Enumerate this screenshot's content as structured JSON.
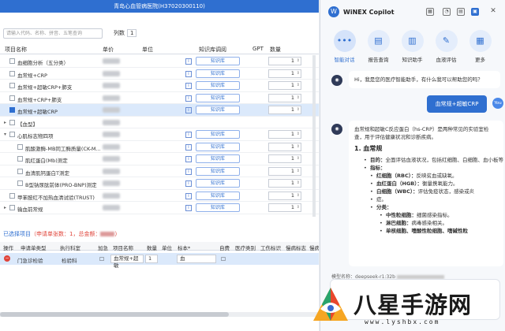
{
  "window": {
    "title": "青岛心血管病医院(H37020300110)"
  },
  "search": {
    "placeholder": "请输入代码、名称、拼音、五笔查询",
    "columns_label": "列数",
    "columns_value": "1"
  },
  "table": {
    "headers": [
      "项目名称",
      "单价",
      "单位",
      "知识库调阅",
      "GPT",
      "数量"
    ],
    "knowledge_button": "知识库",
    "rows": [
      {
        "name": "血细胞分析（五分类）",
        "checked": false,
        "level": 0,
        "qty": "1",
        "kb": true
      },
      {
        "name": "血常规+CRP",
        "checked": false,
        "level": 0,
        "qty": "1",
        "kb": true
      },
      {
        "name": "血常规+超敏CRP+肺支",
        "checked": false,
        "level": 0,
        "qty": "1",
        "kb": true
      },
      {
        "name": "血常规+CRP+肺支",
        "checked": false,
        "level": 0,
        "qty": "1",
        "kb": true
      },
      {
        "name": "血常规+超敏CRP",
        "checked": true,
        "level": 0,
        "qty": "1",
        "kb": true,
        "selected": true
      },
      {
        "name": "【血型】",
        "checked": false,
        "level": 0,
        "qty": "",
        "kb": false,
        "toggle": "▸"
      },
      {
        "name": "心肌标志物四项",
        "checked": false,
        "level": 0,
        "qty": "1",
        "kb": true,
        "toggle": "▾"
      },
      {
        "name": "肌酸激酶-MB同工酶质量(CK-M...",
        "checked": false,
        "level": 1,
        "qty": "1",
        "kb": true
      },
      {
        "name": "肌红蛋白(Mb)测定",
        "checked": false,
        "level": 1,
        "qty": "1",
        "kb": true
      },
      {
        "name": "血清肌钙蛋白T测定",
        "checked": false,
        "level": 1,
        "qty": "1",
        "kb": true
      },
      {
        "name": "B型钠尿肽前体(PRO-BNP)测定",
        "checked": false,
        "level": 1,
        "qty": "1",
        "kb": true
      },
      {
        "name": "甲苯胺红不加热血清试验(TRUST)",
        "checked": false,
        "level": 0,
        "qty": "1",
        "kb": true
      },
      {
        "name": "输血前常规",
        "checked": false,
        "level": 0,
        "qty": "1",
        "kb": true,
        "toggle": "▸"
      }
    ]
  },
  "selected": {
    "label": "已选择项目",
    "summary": "（申请单张数：1，总金额：",
    "summary_end": "）"
  },
  "orders": {
    "headers": [
      "操作",
      "申请单类型",
      "执行科室",
      "加急",
      "项目名称",
      "数量",
      "单位",
      "标本*",
      "自费",
      "医疗类别",
      "工伤标识",
      "慢病标志",
      "慢病"
    ],
    "row": {
      "type": "门急诊检验",
      "dept": "检验科",
      "item": "血常规+超敏",
      "qty": "1",
      "specimen": "血"
    }
  },
  "copilot": {
    "title": "WiNEX Copilot",
    "features": [
      {
        "label": "智能对话",
        "icon": "•••",
        "active": true
      },
      {
        "label": "报告查询",
        "icon": "▤",
        "active": false
      },
      {
        "label": "知识助手",
        "icon": "▥",
        "active": false
      },
      {
        "label": "血液评估",
        "icon": "✎",
        "active": false
      },
      {
        "label": "更多",
        "icon": "▦",
        "active": false
      }
    ],
    "greeting": "Hi，我是您的医疗智能助手，有什么我可以帮助您的吗？",
    "user_message": "血常规+超敏CRP",
    "user_avatar": "You",
    "answer_intro": "血常规和超敏C反应蛋白（hs-CRP）是两种常见的实验室检查，用于评估健康状况和诊断疾病。",
    "answer_heading": "1. 血常规",
    "answer_lines": [
      {
        "lvl": 1,
        "bold": "目的：",
        "text": "全面评估血液状况，包括红细胞、白细胞、血小板等。"
      },
      {
        "lvl": 1,
        "bold": "指标：",
        "text": ""
      },
      {
        "lvl": 2,
        "bold": "红细胞（RBC）：",
        "text": "反映贫血或缺氧。"
      },
      {
        "lvl": 2,
        "bold": "血红蛋白（HGB）：",
        "text": "衡量携氧能力。"
      },
      {
        "lvl": 2,
        "bold": "白细胞（WBC）：",
        "text": "评估免疫状态，感染或炎"
      },
      {
        "lvl": 2,
        "bold": "",
        "text": "症。"
      },
      {
        "lvl": 2,
        "bold": "分类：",
        "text": ""
      },
      {
        "lvl": 3,
        "bold": "中性粒细胞：",
        "text": "细菌感染指标。"
      },
      {
        "lvl": 3,
        "bold": "淋巴细胞：",
        "text": "病毒感染相关。"
      },
      {
        "lvl": 3,
        "bold": "单核细胞、嗜酸性粒细胞、嗜碱性粒",
        "text": ""
      }
    ],
    "model_label": "模型名称：",
    "model_value": "deepseek-r1:32b"
  },
  "watermark": {
    "text": "八星手游网",
    "url": "www.lyshbx.com"
  },
  "colors": {
    "accent": "#2f6fd0",
    "header": "#2f6fd0",
    "selected_row": "#dbe9fb",
    "danger": "#e0443a"
  }
}
